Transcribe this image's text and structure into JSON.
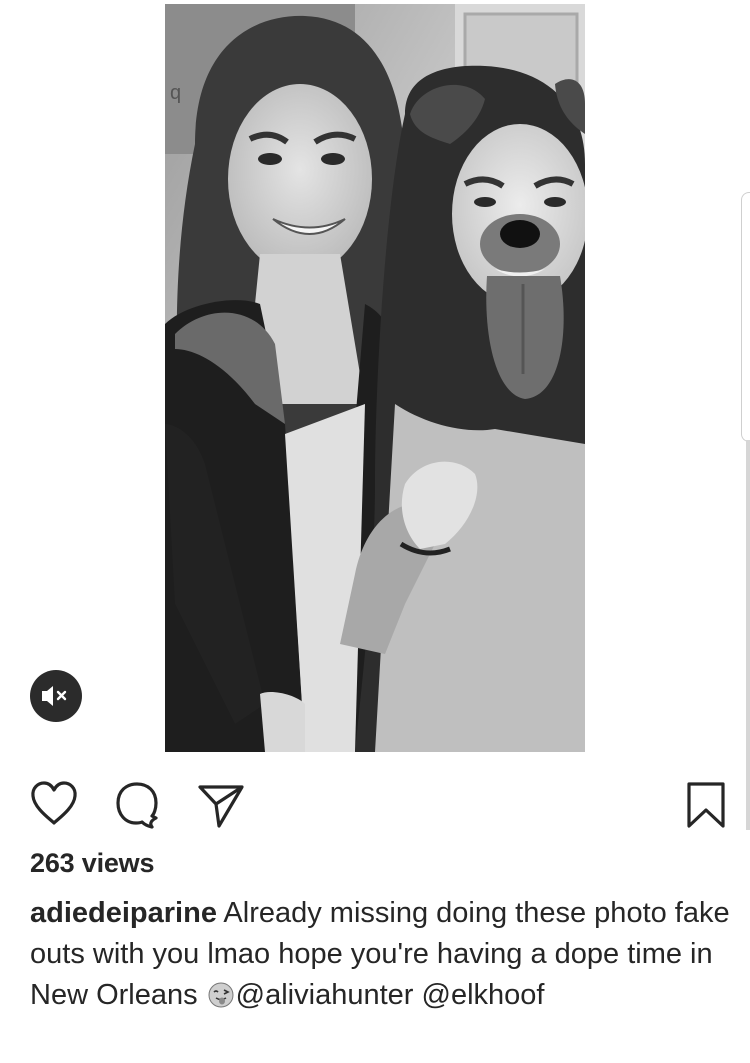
{
  "post": {
    "media_alt": "black and white video still of two young women, one wearing a dog face filter",
    "views": "263 views",
    "caption": {
      "username": "adiedeiparine",
      "text_part1": " Already missing doing these photo fake outs with you lmao hope you're having a dope time in New Orleans ",
      "emoji": "face-with-tongue-emoji",
      "mention1": "@aliviahunter",
      "space": " ",
      "mention2": "@elkhoof"
    }
  },
  "icons": {
    "mute": "speaker-muted-icon",
    "like": "heart-icon",
    "comment": "comment-bubble-icon",
    "share": "paper-plane-icon",
    "save": "bookmark-icon"
  }
}
